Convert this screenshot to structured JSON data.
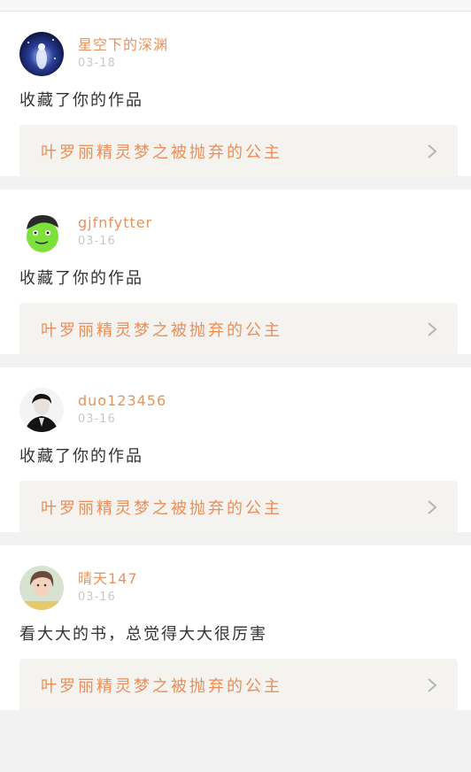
{
  "posts": [
    {
      "username": "星空下的深渊",
      "date": "03-18",
      "comment": "收藏了你的作品",
      "book_title": "叶罗丽精灵梦之被抛弃的公主",
      "avatar_colors": [
        "#0b1a5a",
        "#6a8cd8"
      ]
    },
    {
      "username": "gjfnfytter",
      "date": "03-16",
      "comment": "收藏了你的作品",
      "book_title": "叶罗丽精灵梦之被抛弃的公主",
      "avatar_colors": [
        "#7ee03a",
        "#2a2a2a"
      ]
    },
    {
      "username": "duo123456",
      "date": "03-16",
      "comment": "收藏了你的作品",
      "book_title": "叶罗丽精灵梦之被抛弃的公主",
      "avatar_colors": [
        "#111111",
        "#d8d8d8"
      ]
    },
    {
      "username": "晴天147",
      "date": "03-16",
      "comment": "看大大的书，总觉得大大很厉害",
      "book_title": "叶罗丽精灵梦之被抛弃的公主",
      "avatar_colors": [
        "#cfd9c6",
        "#e9c5a7"
      ]
    }
  ]
}
